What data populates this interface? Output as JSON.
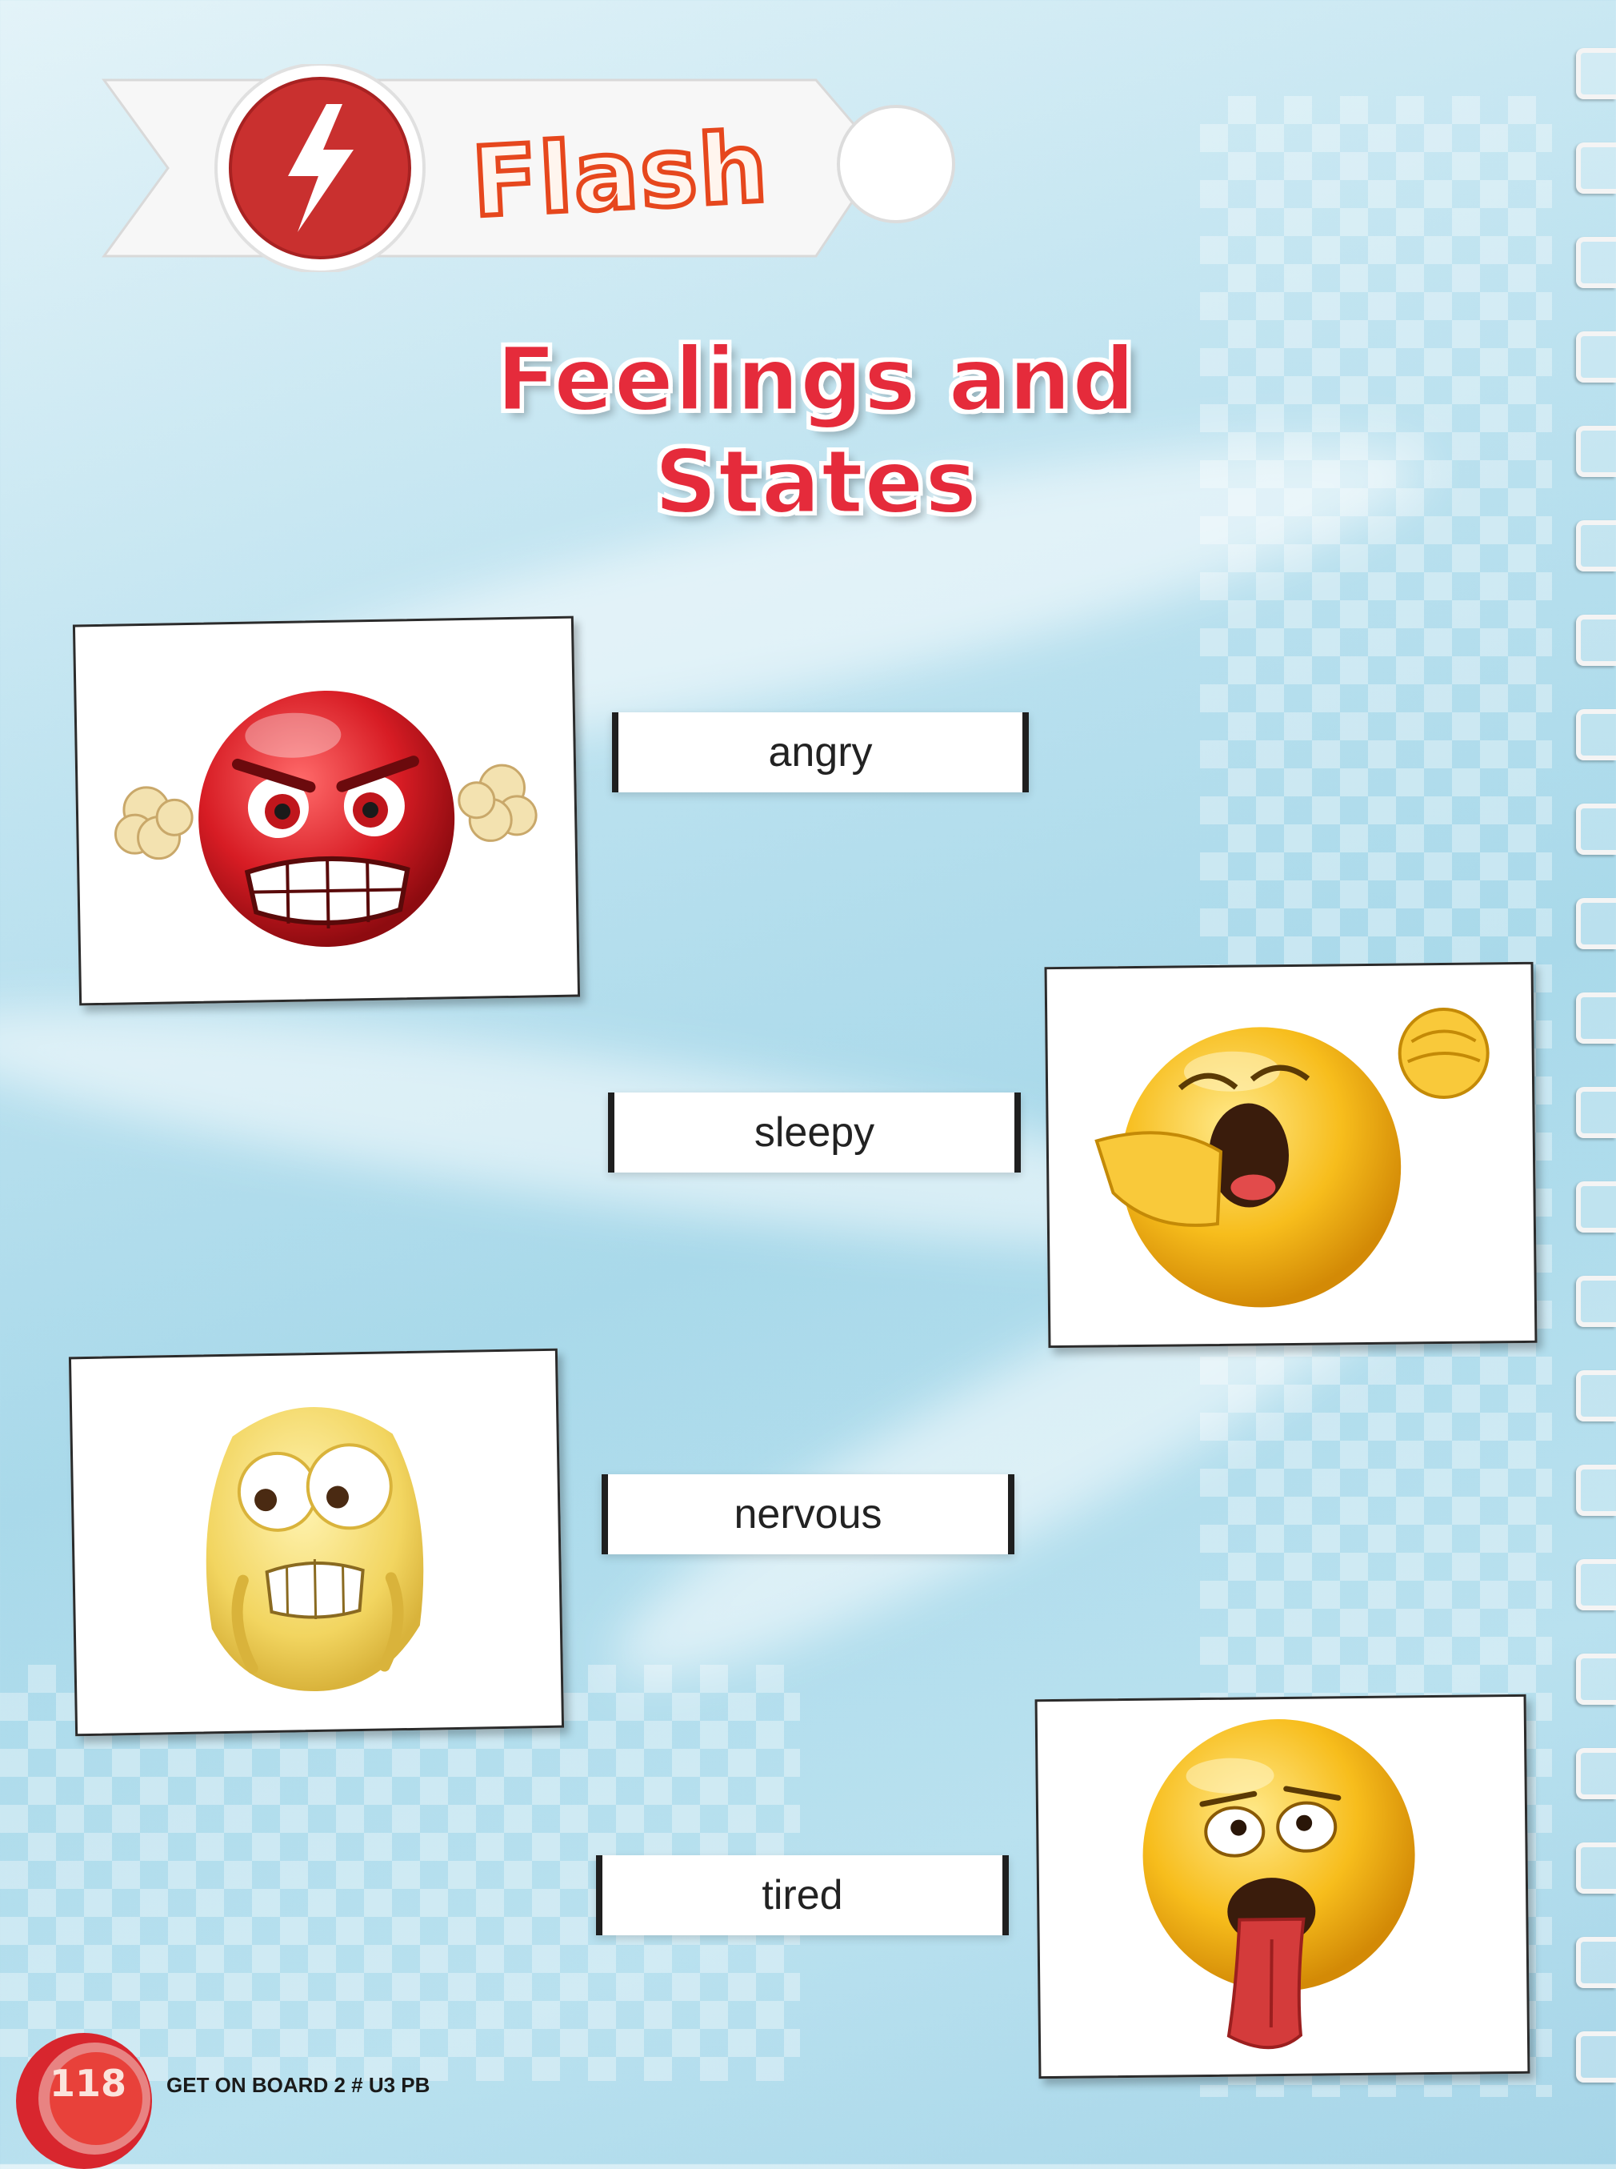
{
  "header": {
    "section_label": "Flash",
    "icon": "lightning-bolt-icon"
  },
  "title": "Feelings and States",
  "items": [
    {
      "word": "angry",
      "emoji": "angry-face-icon"
    },
    {
      "word": "sleepy",
      "emoji": "yawning-face-icon"
    },
    {
      "word": "nervous",
      "emoji": "nervous-face-icon"
    },
    {
      "word": "tired",
      "emoji": "exhausted-face-icon"
    }
  ],
  "footer": {
    "page_number": "118",
    "book_ref": "GET ON BOARD 2 # U3 PB"
  },
  "colors": {
    "accent_red": "#e52b3b",
    "flash_orange": "#e6471d",
    "background_blue": "#a9d9ea"
  }
}
